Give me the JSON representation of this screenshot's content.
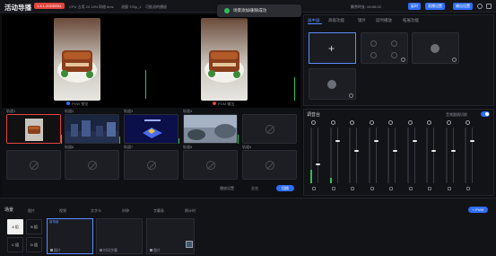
{
  "header": {
    "title": "活动导播",
    "badge": "1.4.1-20230911",
    "stats": [
      "CPU 占用 20.14%",
      "网络 6ms",
      "流量 725p_1",
      "可推流的播放"
    ],
    "timer": "剩余时长: 00:00:22",
    "buttons": [
      "延时",
      "直播设置",
      "输出设置"
    ]
  },
  "toast": {
    "text": "场景添加/删除成功",
    "color": "#2fbd5a"
  },
  "monitors": {
    "pvw_label": "PVW 预览",
    "pgm_label": "PGM 输出",
    "accent": "#2f6ef5"
  },
  "sources": {
    "tiles": [
      {
        "label": "轨道1",
        "has_image": true
      },
      {
        "label": "轨道2",
        "has_image": true
      },
      {
        "label": "轨道3",
        "has_image": true
      },
      {
        "label": "轨道4",
        "has_image": true
      },
      {
        "label": "",
        "has_image": false
      },
      {
        "label": "轨道6",
        "has_image": false
      },
      {
        "label": "轨道7",
        "has_image": false
      },
      {
        "label": "轨道8",
        "has_image": false
      },
      {
        "label": "轨道9",
        "has_image": false
      },
      {
        "label": "轨道10",
        "has_image": false
      }
    ],
    "controls": [
      "播放设置",
      "总览",
      "切换"
    ]
  },
  "layout_panel": {
    "tabs": [
      "画中画",
      "高级功能",
      "镜片",
      "延时播放",
      "拓展功能"
    ],
    "active_tab": "画中画"
  },
  "mixer": {
    "title": "调音台",
    "follow_label": "音频跟随切换",
    "channels": [
      {
        "level": 0.25,
        "fader": 0.35
      },
      {
        "level": 0.1,
        "fader": 0.78
      },
      {
        "level": 0.0,
        "fader": 0.6
      },
      {
        "level": 0.0,
        "fader": 0.78
      },
      {
        "level": 0.0,
        "fader": 0.6
      },
      {
        "level": 0.0,
        "fader": 0.78
      },
      {
        "level": 0.0,
        "fader": 0.6
      },
      {
        "level": 0.0,
        "fader": 0.6
      },
      {
        "level": 0.0,
        "fader": 0.78
      }
    ]
  },
  "scenes": {
    "title": "场景",
    "tabs": [
      "图片",
      "视频",
      "文字卡",
      "时钟",
      "字幕条",
      "倒计时"
    ],
    "groups": [
      "A 组",
      "B 组",
      "C 组",
      "D 组"
    ],
    "add_button": "+ PVW",
    "cards": [
      {
        "title": "新场景",
        "item": "图片"
      },
      {
        "title": "",
        "item": "时间字幕"
      },
      {
        "title": "",
        "item": "图片"
      }
    ]
  }
}
